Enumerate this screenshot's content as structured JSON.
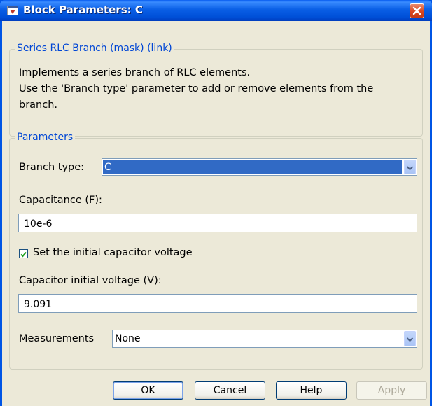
{
  "window": {
    "title": "Block Parameters: C",
    "icon": "simulink-block-icon",
    "close_icon": "close-icon"
  },
  "description_group": {
    "legend": "Series RLC Branch (mask) (link)",
    "lines": [
      "Implements a series branch of RLC elements.",
      "Use the 'Branch type' parameter to add or remove elements from the",
      "branch."
    ]
  },
  "parameters_group": {
    "legend": "Parameters",
    "branch_type": {
      "label": "Branch type:",
      "value": "C"
    },
    "capacitance": {
      "label": "Capacitance (F):",
      "value": "10e-6"
    },
    "initial_voltage_checkbox": {
      "label": "Set the initial capacitor voltage",
      "checked": true
    },
    "initial_voltage": {
      "label": "Capacitor initial voltage (V):",
      "value": "9.091"
    },
    "measurements": {
      "label": "Measurements",
      "value": "None"
    }
  },
  "buttons": {
    "ok": "OK",
    "cancel": "Cancel",
    "help": "Help",
    "apply": "Apply"
  },
  "colors": {
    "title_bar": "#0055e5",
    "dialog_bg": "#ece9d8",
    "legend_text": "#0046d5",
    "selection": "#316ac5"
  }
}
